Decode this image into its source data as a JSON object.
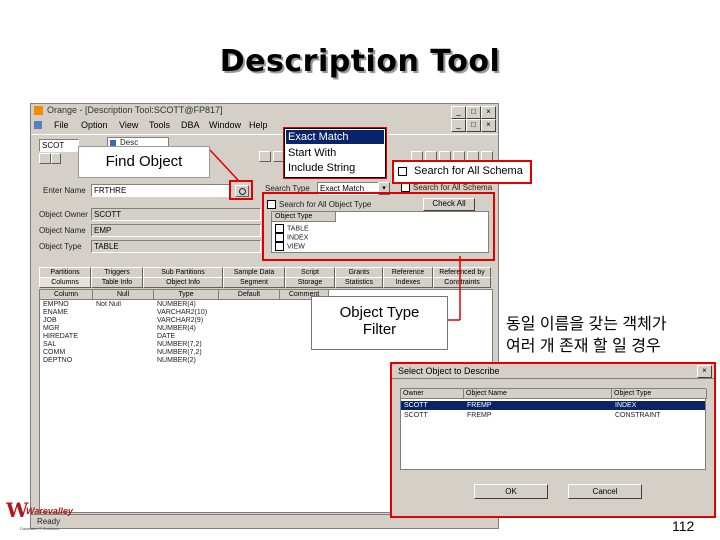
{
  "slide": {
    "title": "Description Tool",
    "page_number": "112"
  },
  "main_window": {
    "title": "Orange - [Description Tool:SCOTT@FP817]",
    "menu": [
      "File",
      "Option",
      "View",
      "Tools",
      "DBA",
      "Window",
      "Help"
    ],
    "controls": [
      "_",
      "□",
      "×"
    ],
    "child_controls": [
      "_",
      "□",
      "×"
    ],
    "toolbar_combo": "SCOT",
    "tab_title": "Desc",
    "find_label": "Enter Name",
    "find_value": "FRTHRE",
    "owner_label": "Object Owner",
    "owner_value": "SCOTT",
    "name_label": "Object Name",
    "name_value": "EMP",
    "type_label": "Object Type",
    "type_value": "TABLE",
    "search_type_label": "Search Type",
    "search_type_value": "Exact Match",
    "search_all_label": "Search for All Schema",
    "search_obj_type_label": "Search for All Object Type",
    "check_all_button": "Check All",
    "object_type_header": "Object Type",
    "object_types": [
      "TABLE",
      "INDEX",
      "VIEW"
    ],
    "tabs_top": [
      "Partitions",
      "Triggers",
      "Sub Partitions",
      "Sample Data",
      "Script",
      "Grants",
      "Reference",
      "Referenced by"
    ],
    "tabs_bottom": [
      "Columns",
      "Table Info",
      "Object Info",
      "Segment",
      "Storage",
      "Statistics",
      "Indexes",
      "Constraints"
    ],
    "columns_header": [
      "Column",
      "Null",
      "Type",
      "Default",
      "Comment"
    ],
    "columns_rows": [
      [
        "EMPNO",
        "Not Null",
        "NUMBER(4)"
      ],
      [
        "ENAME",
        "",
        "VARCHAR2(10)"
      ],
      [
        "JOB",
        "",
        "VARCHAR2(9)"
      ],
      [
        "MGR",
        "",
        "NUMBER(4)"
      ],
      [
        "HIREDATE",
        "",
        "DATE"
      ],
      [
        "SAL",
        "",
        "NUMBER(7,2)"
      ],
      [
        "COMM",
        "",
        "NUMBER(7,2)"
      ],
      [
        "DEPTNO",
        "",
        "NUMBER(2)"
      ]
    ],
    "status": "Ready"
  },
  "search_type_dropdown": {
    "options": [
      "Exact Match",
      "Start With",
      "Include String"
    ]
  },
  "callouts": {
    "find_object": "Find Object",
    "search_all_schema": "Search for All Schema",
    "object_type_filter_line1": "Object Type",
    "object_type_filter_line2": "Filter",
    "korean_line1": "동일 이름을 갖는 객체가",
    "korean_line2": "여러 개 존재 할 일 경우"
  },
  "dialog": {
    "title": "Select Object to Describe",
    "close": "×",
    "headers": [
      "Owner",
      "Object Name",
      "Object Type"
    ],
    "rows": [
      [
        "SCOTT",
        "FREMP",
        "INDEX"
      ],
      [
        "SCOTT",
        "FREMP",
        "CONSTRAINT"
      ]
    ],
    "ok_button": "OK",
    "cancel_button": "Cancel"
  },
  "logo": {
    "text": "Warevalley",
    "tagline": "Database IT Solutions"
  },
  "colors": {
    "callout_red": "#e00000",
    "selected_row": "#0a246a",
    "window_gray": "#d4d0c8"
  }
}
